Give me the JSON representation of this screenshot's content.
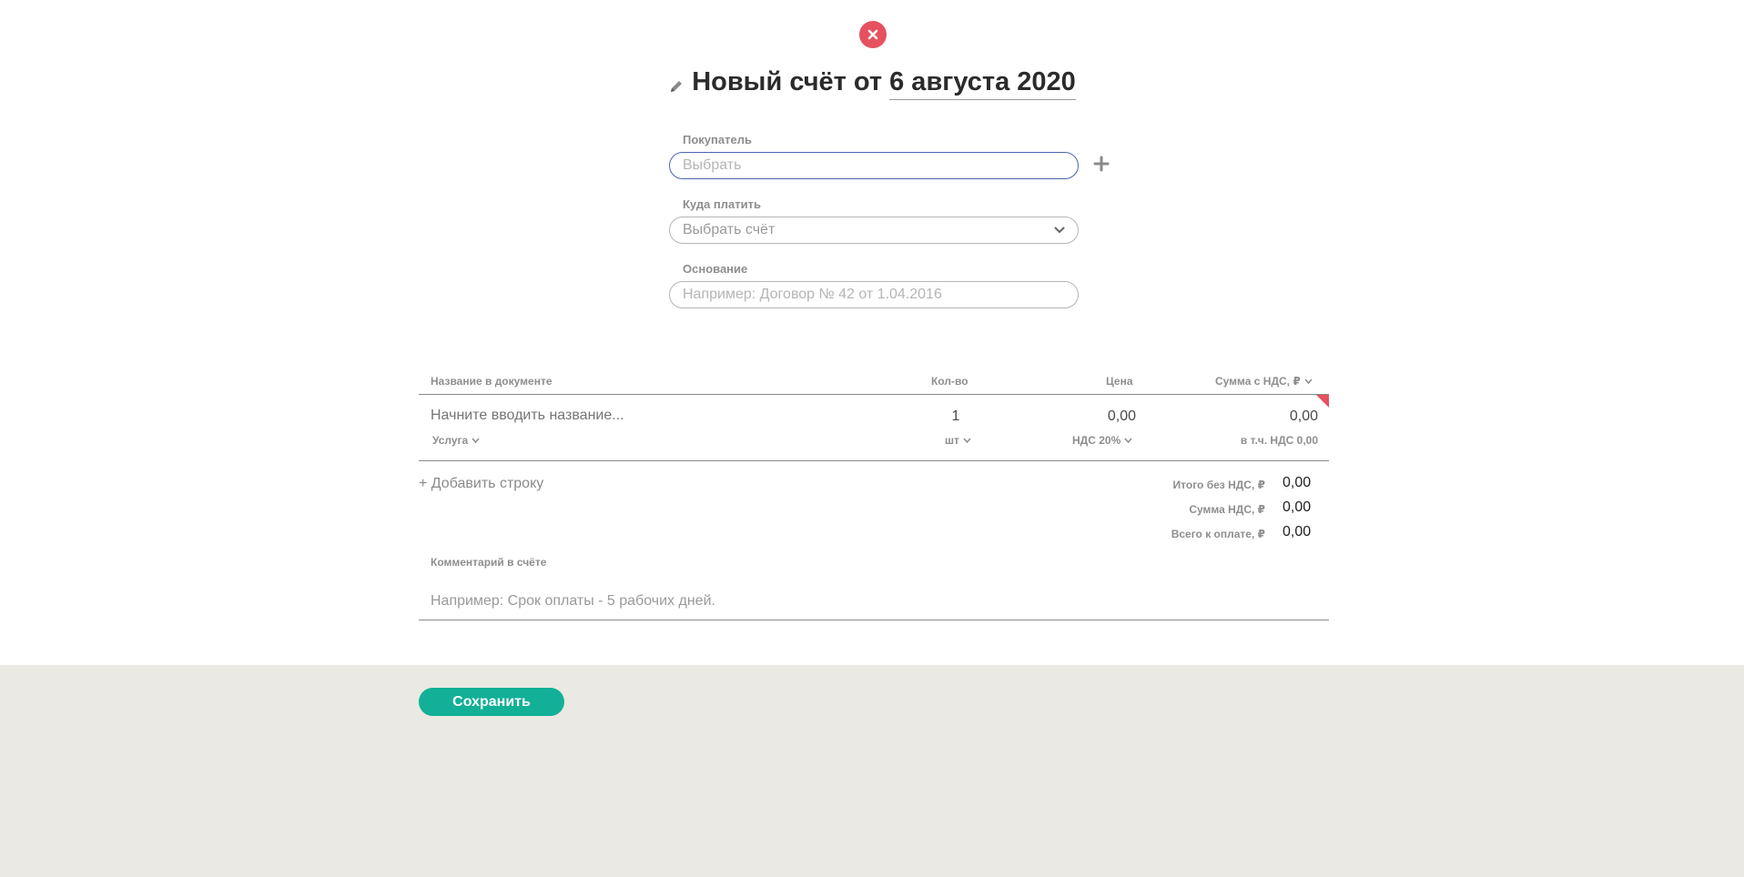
{
  "header": {
    "title": "Новый счёт от",
    "date": "6 августа 2020"
  },
  "buyer": {
    "label": "Покупатель",
    "placeholder": "Выбрать"
  },
  "pay_to": {
    "label": "Куда платить",
    "value": "Выбрать счёт"
  },
  "basis": {
    "label": "Основание",
    "placeholder": "Например: Договор № 42 от 1.04.2016"
  },
  "table": {
    "columns": {
      "name": "Название в документе",
      "qty": "Кол-во",
      "price": "Цена",
      "sum": "Сумма с НДС, ₽"
    },
    "row": {
      "name_placeholder": "Начните вводить название...",
      "qty": "1",
      "price": "0,00",
      "sum": "0,00",
      "type": "Услуга",
      "unit": "шт",
      "vat": "НДС 20%",
      "vat_included": "в т.ч. НДС 0,00"
    }
  },
  "add_row": "+ Добавить строку",
  "totals": {
    "net_label": "Итого без НДС, ₽",
    "net_value": "0,00",
    "vat_label": "Сумма НДС, ₽",
    "vat_value": "0,00",
    "total_label": "Всего к оплате, ₽",
    "total_value": "0,00"
  },
  "comment": {
    "label": "Комментарий в счёте",
    "placeholder": "Например: Срок оплаты - 5 рабочих дней."
  },
  "save_label": "Сохранить",
  "colors": {
    "accent": "#12b097",
    "danger": "#e5515f",
    "focus": "#4a63b0",
    "footer_bg": "#eae9e4"
  }
}
